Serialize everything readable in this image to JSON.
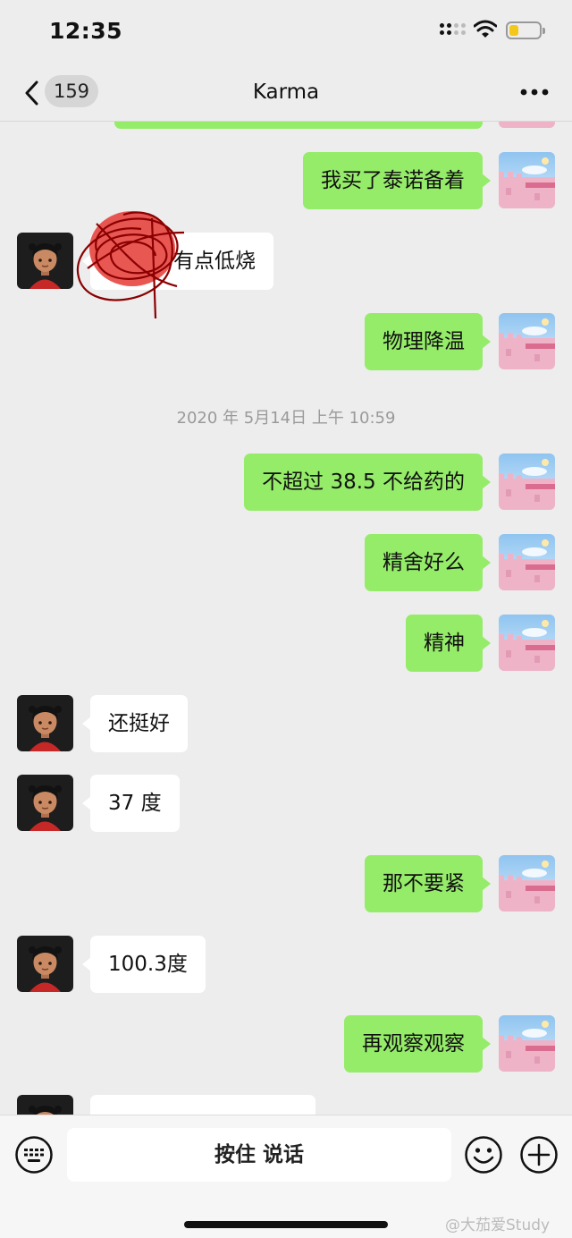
{
  "status_bar": {
    "time": "12:35",
    "battery_level": 0.3,
    "battery_color": "#f4c81a"
  },
  "nav": {
    "back_label": "159",
    "title": "Karma"
  },
  "messages": [
    {
      "sender": "me",
      "text": ""
    },
    {
      "sender": "me",
      "text": "我买了泰诺备着"
    },
    {
      "sender": "them",
      "text": "有点低烧"
    },
    {
      "sender": "me",
      "text": "物理降温"
    },
    {
      "timestamp": "2020 年 5月14日 上午 10:59"
    },
    {
      "sender": "me",
      "text": "不超过 38.5 不给药的"
    },
    {
      "sender": "me",
      "text": "精舍好么"
    },
    {
      "sender": "me",
      "text": "精神"
    },
    {
      "sender": "them",
      "text": "还挺好"
    },
    {
      "sender": "them",
      "text": "37 度"
    },
    {
      "sender": "me",
      "text": "那不要紧"
    },
    {
      "sender": "them",
      "text": "100.3度"
    },
    {
      "sender": "me",
      "text": "再观察观察"
    },
    {
      "sender": "them",
      "text": ""
    }
  ],
  "input_bar": {
    "hold_to_talk_label": "按住 说话"
  },
  "watermark": "@大茄爱Study",
  "colors": {
    "my_bubble": "#95ec69",
    "their_bubble": "#ffffff",
    "background": "#ededed"
  },
  "icons": [
    "chevron-left-icon",
    "more-icon",
    "keyboard-icon",
    "emoji-icon",
    "plus-icon",
    "wifi-icon",
    "battery-icon",
    "signal-icon"
  ]
}
